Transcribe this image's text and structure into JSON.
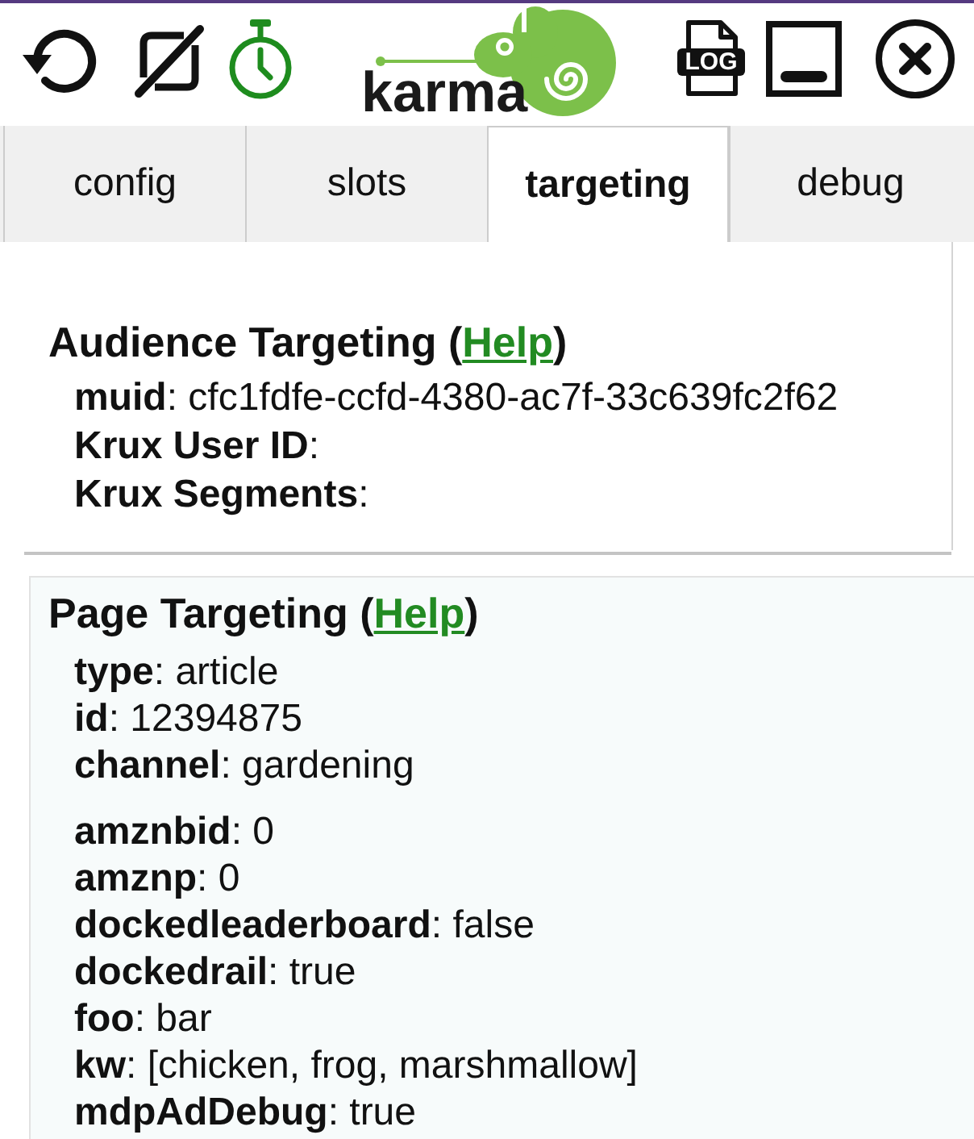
{
  "toolbar": [
    {
      "kind": "refresh"
    },
    {
      "kind": "hide"
    },
    {
      "kind": "timer"
    }
  ],
  "logo": {
    "text": "karma"
  },
  "actions": [
    {
      "kind": "log",
      "label": "LOG"
    },
    {
      "kind": "minimize"
    },
    {
      "kind": "close"
    }
  ],
  "tabs": [
    {
      "label": "config",
      "selected": false
    },
    {
      "label": "slots",
      "selected": false
    },
    {
      "label": "targeting",
      "selected": true
    },
    {
      "label": "debug",
      "selected": false
    }
  ],
  "audience_targeting": {
    "heading_start": "Audience Targeting (",
    "help_link": "Help",
    "heading_end": ")",
    "entries": [
      "**muid**: cfc1fdfe-ccfd-4380-ac7f-33c639fc2f62",
      "**Krux User ID**:",
      "**Krux Segments**:"
    ]
  },
  "page_targeting": {
    "heading_start": "Page Targeting (",
    "help_link": "Help",
    "heading_end": ")",
    "entry_groups": [
      [
        "**type**: article",
        "**id**: 12394875",
        "**channel**: gardening"
      ],
      [
        "**amznbid**: 0",
        "**amznp**: 0",
        "**dockedleaderboard**: false",
        "**dockedrail**: true",
        "**foo**: bar",
        "**kw**: [chicken, frog, marshmallow]",
        "**mdpAdDebug**: true"
      ]
    ]
  }
}
